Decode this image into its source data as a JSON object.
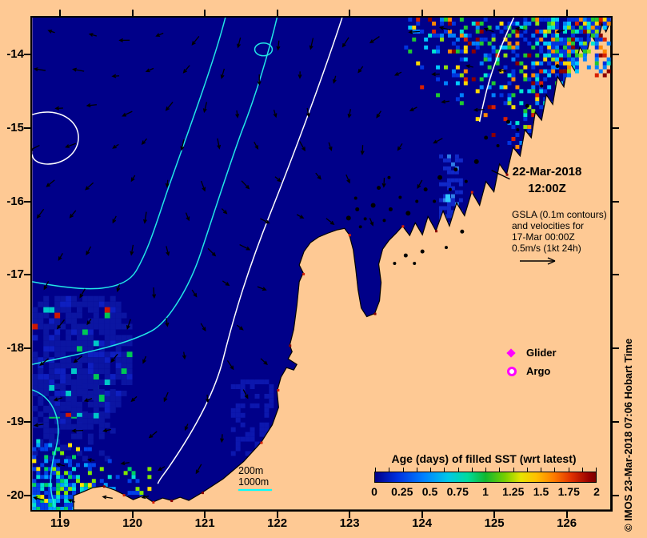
{
  "figure": {
    "background_color": "#fec994",
    "ocean_color": "#000089",
    "land_color": "#fec994"
  },
  "axes": {
    "x_ticks": [
      "119",
      "120",
      "121",
      "122",
      "123",
      "124",
      "125",
      "126"
    ],
    "y_ticks": [
      "-14",
      "-15",
      "-16",
      "-17",
      "-18",
      "-19",
      "-20"
    ]
  },
  "annotations": {
    "date_line1": "22-Mar-2018",
    "date_line2": "12:00Z",
    "gsla_lines": [
      "GSLA (0.1m contours)",
      "and velocities for",
      "17-Mar 00:00Z",
      "0.5m/s (1kt 24h)"
    ],
    "watermark": "© IMOS 23-Mar-2018 07:06 Hobart Time"
  },
  "legend": {
    "glider_label": "Glider",
    "argo_label": "Argo",
    "marker_color": "#ff00ff"
  },
  "bathy_legend": {
    "label_200": "200m",
    "label_1000": "1000m",
    "line_color": "#00ffff"
  },
  "colorbar": {
    "title": "Age (days) of filled SST (wrt latest)",
    "tick_labels": [
      "0",
      "0.25",
      "0.5",
      "0.75",
      "1",
      "1.25",
      "1.5",
      "1.75",
      "2"
    ],
    "min": 0,
    "max": 2,
    "gradient": [
      "#000089 0%",
      "#0030e0 10%",
      "#0080ff 22%",
      "#00c8e8 33%",
      "#00dc9c 42%",
      "#10b830 50%",
      "#7ad000 59%",
      "#e8e400 66%",
      "#ffc000 73%",
      "#ff7c00 81%",
      "#e03000 89%",
      "#980000 97%",
      "#7a0000 100%"
    ]
  },
  "map": {
    "contour_gsla_color": "#ffffff",
    "contour_bathy_color": "#22e7e7",
    "arrow_color": "#000000",
    "sst_palette": [
      "#0034e0",
      "#0080ff",
      "#00c8ff",
      "#00e8d0",
      "#20c830",
      "#90e010",
      "#ffd800",
      "#ff8800",
      "#d82000",
      "#8b0000"
    ]
  }
}
